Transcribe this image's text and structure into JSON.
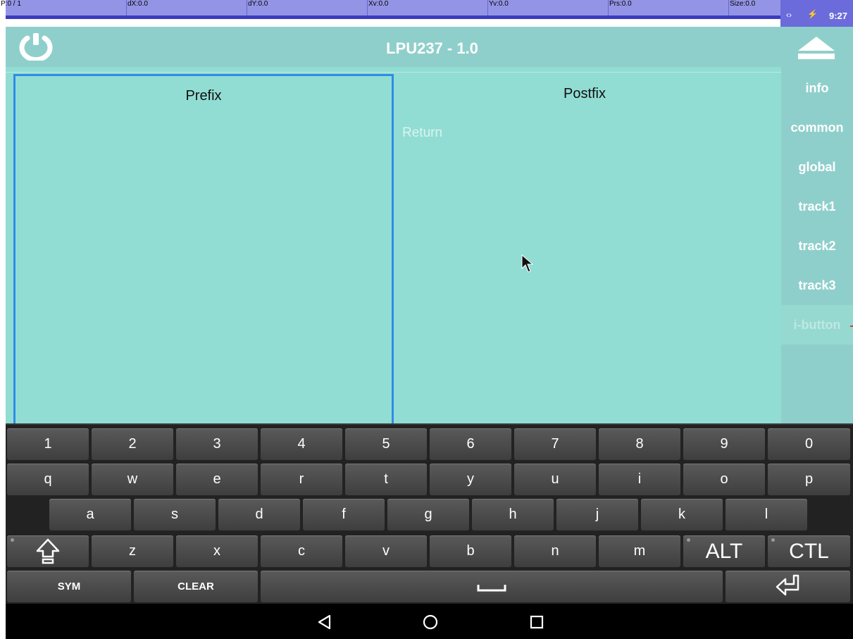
{
  "debug_bar": {
    "pointer": "P:0 / 1",
    "dx": "dX:0.0",
    "dy": "dY:0.0",
    "xv": "Xv:0.0",
    "yv": "Yv:0.0",
    "prs": "Prs:0.0",
    "size": "Size:0.0"
  },
  "status_bar": {
    "arrows": "‹›",
    "time": "9:27"
  },
  "header": {
    "title": "LPU237 - 1.0"
  },
  "panels": {
    "prefix_title": "Prefix",
    "postfix_title": "Postfix",
    "postfix_items": [
      "Return"
    ]
  },
  "side_menu": {
    "items": [
      "info",
      "common",
      "global",
      "track1",
      "track2",
      "track3",
      "i-button"
    ],
    "active": "i-button"
  },
  "keyboard": {
    "row1": [
      "1",
      "2",
      "3",
      "4",
      "5",
      "6",
      "7",
      "8",
      "9",
      "0"
    ],
    "row2": [
      "q",
      "w",
      "e",
      "r",
      "t",
      "y",
      "u",
      "i",
      "o",
      "p"
    ],
    "row3": [
      "a",
      "s",
      "d",
      "f",
      "g",
      "h",
      "j",
      "k",
      "l"
    ],
    "row4": [
      "z",
      "x",
      "c",
      "v",
      "b",
      "n",
      "m"
    ],
    "alt": "ALT",
    "ctl": "CTL",
    "sym": "SYM",
    "clear": "CLEAR"
  },
  "icons": {
    "power": "power-icon",
    "upload": "upload-icon",
    "shift": "shift-icon",
    "space": "space-icon",
    "enter": "enter-icon",
    "back": "back-icon",
    "home": "home-icon",
    "recents": "recents-icon"
  },
  "colors": {
    "accent": "#2f8ce6",
    "panel_bg": "#91ddd3",
    "header_bg": "#8fcfcb"
  }
}
